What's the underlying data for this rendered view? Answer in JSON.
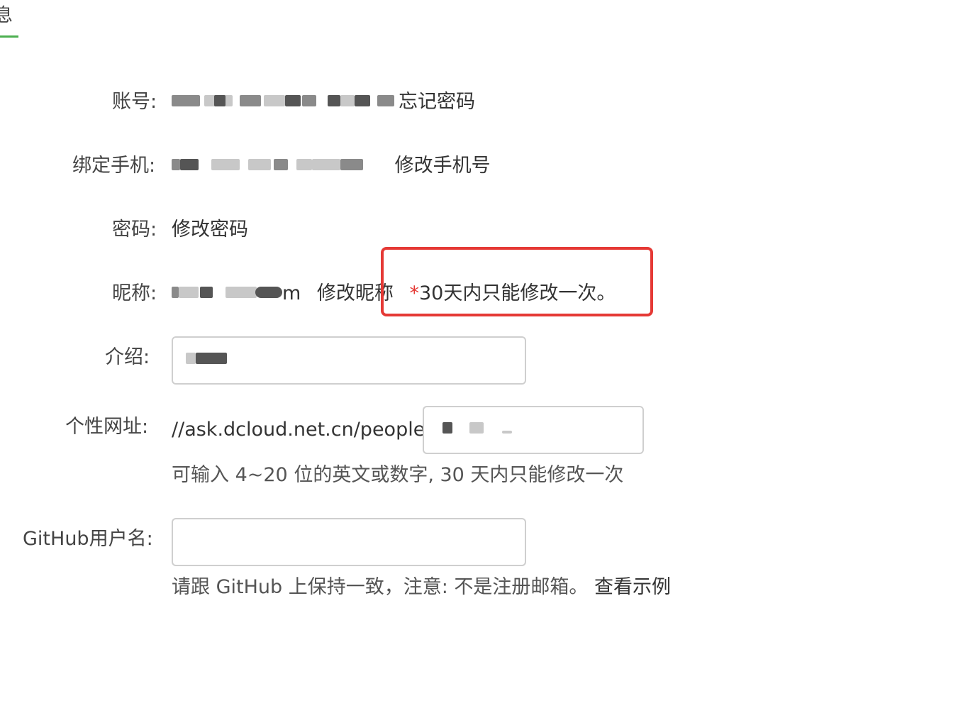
{
  "tab": {
    "label": "息"
  },
  "account": {
    "label": "账号:",
    "forgot_password": "忘记密码"
  },
  "phone": {
    "label": "绑定手机:",
    "change_phone": "修改手机号"
  },
  "password": {
    "label": "密码:",
    "change_password": "修改密码"
  },
  "nickname": {
    "label": "昵称:",
    "suffix": "m",
    "change_nickname": "修改昵称",
    "notice_star": "*",
    "notice_text": "30天内只能修改一次。",
    "highlight_color": "#e53935"
  },
  "intro": {
    "label": "介绍:"
  },
  "url": {
    "label": "个性网址:",
    "prefix": "//ask.dcloud.net.cn/people/",
    "hint": "可输入 4~20 位的英文或数字, 30 天内只能修改一次"
  },
  "github": {
    "label": "GitHub用户名:",
    "value": "",
    "hint": "请跟 GitHub 上保持一致，注意: 不是注册邮箱。",
    "example_link": "查看示例"
  },
  "colors": {
    "accent_green": "#4caf50",
    "alert_red": "#e53935"
  }
}
